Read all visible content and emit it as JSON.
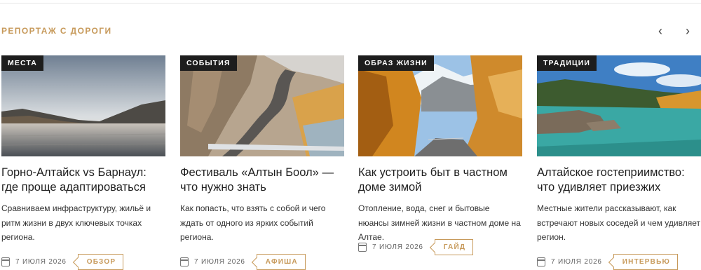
{
  "section": {
    "title": "РЕПОРТАЖ С ДОРОГИ",
    "prev": "‹",
    "next": "›"
  },
  "cards": [
    {
      "tag": "МЕСТА",
      "title": "Горно-Алтайск vs Барнаул: где проще адаптироваться",
      "text": "Сравниваем инфраструктуру, жильё и ритм жизни в двух ключевых точках региона.",
      "date": "7 ИЮЛЯ 2026",
      "badge": "ОБЗОР"
    },
    {
      "tag": "СОБЫТИЯ",
      "title": "Фестиваль «Алтын Боол» — что нужно знать",
      "text": "Как попасть, что взять с собой и чего ждать от одного из ярких событий региона.",
      "date": "7 ИЮЛЯ 2026",
      "badge": "АФИША"
    },
    {
      "tag": "ОБРАЗ ЖИЗНИ",
      "title": "Как устроить быт в частном доме зимой",
      "text": "Отопление, вода, снег и бытовые нюансы зимней жизни в частном доме на Алтае.",
      "date": "7 ИЮЛЯ 2026",
      "badge": "ГАЙД"
    },
    {
      "tag": "ТРАДИЦИИ",
      "title": "Алтайское гостеприимство: что удивляет приезжих",
      "text": "Местные жители рассказывают, как встречают новых соседей и чем удивляет регион.",
      "date": "7 ИЮЛЯ 2026",
      "badge": "ИНТЕРВЬЮ"
    }
  ]
}
